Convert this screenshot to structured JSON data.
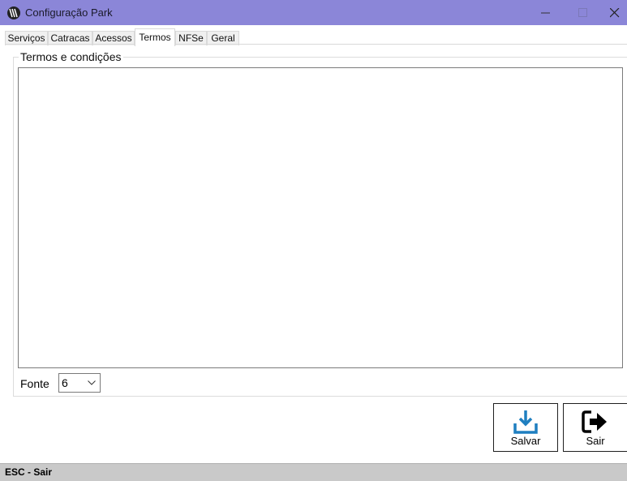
{
  "window": {
    "title": "Configuração Park",
    "icon": "app-logo-icon"
  },
  "tabs": [
    {
      "label": "Serviços",
      "active": false
    },
    {
      "label": "Catracas",
      "active": false
    },
    {
      "label": "Acessos",
      "active": false
    },
    {
      "label": "Termos",
      "active": true
    },
    {
      "label": "NFSe",
      "active": false
    },
    {
      "label": "Geral",
      "active": false
    }
  ],
  "termos": {
    "group_title": "Termos e condições",
    "text": "",
    "fonte_label": "Fonte",
    "fonte_value": "6"
  },
  "actions": {
    "save_label": "Salvar",
    "save_icon": "download-icon",
    "exit_label": "Sair",
    "exit_icon": "exit-arrow-icon"
  },
  "status": {
    "text": "ESC - Sair"
  },
  "colors": {
    "titlebar": "#8b86d8",
    "accent": "#1f7fc0"
  }
}
